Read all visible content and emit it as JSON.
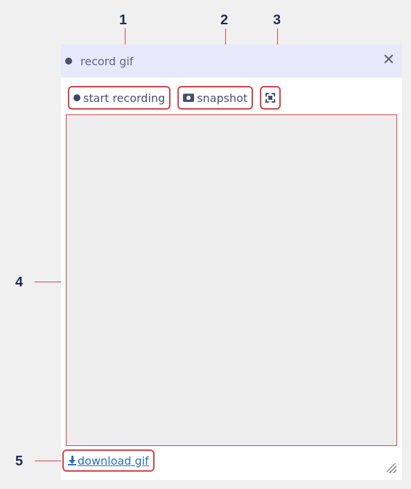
{
  "callouts": [
    "1",
    "2",
    "3",
    "4",
    "5"
  ],
  "window": {
    "title": "record gif",
    "close_label": "✕"
  },
  "toolbar": {
    "start_recording_label": "start recording",
    "snapshot_label": "snapshot"
  },
  "download": {
    "label": "download gif"
  },
  "colors": {
    "accent": "#d04040",
    "title_bg": "#e8e8fb",
    "link": "#2a6cc4"
  }
}
